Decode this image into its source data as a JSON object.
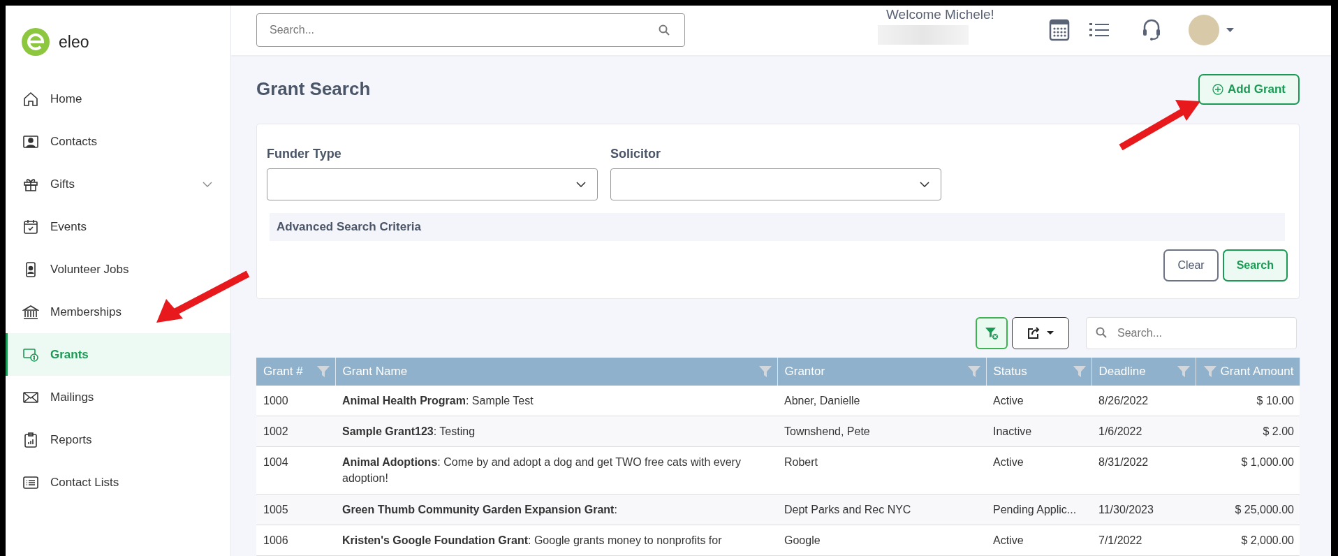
{
  "brand": {
    "name": "eleo"
  },
  "sidebar": {
    "items": [
      {
        "label": "Home",
        "kind": "link",
        "selected": false
      },
      {
        "label": "Contacts",
        "kind": "link",
        "selected": false
      },
      {
        "label": "Gifts",
        "kind": "group",
        "selected": false
      },
      {
        "label": "Events",
        "kind": "link",
        "selected": false
      },
      {
        "label": "Volunteer Jobs",
        "kind": "link",
        "selected": false
      },
      {
        "label": "Memberships",
        "kind": "link",
        "selected": false
      },
      {
        "label": "Grants",
        "kind": "link",
        "selected": true
      },
      {
        "label": "Mailings",
        "kind": "link",
        "selected": false
      },
      {
        "label": "Reports",
        "kind": "link",
        "selected": false
      },
      {
        "label": "Contact Lists",
        "kind": "link",
        "selected": false
      }
    ]
  },
  "header": {
    "search": {
      "placeholder": "Search..."
    },
    "welcome": "Welcome Michele!"
  },
  "page": {
    "title": "Grant Search",
    "add_button": "Add Grant"
  },
  "filters": {
    "fields": [
      {
        "label": "Funder Type"
      },
      {
        "label": "Solicitor"
      }
    ],
    "advanced": "Advanced Search Criteria",
    "buttons": [
      {
        "label": "Clear",
        "kind": "secondary"
      },
      {
        "label": "Search",
        "kind": "primary"
      }
    ]
  },
  "table": {
    "search": {
      "placeholder": "Search..."
    },
    "columns": [
      "Grant #",
      "Grant Name",
      "Grantor",
      "Status",
      "Deadline",
      "Grant Amount"
    ],
    "rows": [
      [
        "1000",
        "**Animal Health Program**: Sample Test",
        "Abner, Danielle",
        "Active",
        "8/26/2022",
        "$ 10.00"
      ],
      [
        "1002",
        "**Sample Grant123**: Testing",
        "Townshend, Pete",
        "Inactive",
        "1/6/2022",
        "$ 2.00"
      ],
      [
        "1004",
        "**Animal Adoptions**: Come by and adopt a dog and get TWO free cats with every adoption!",
        "Robert",
        "Active",
        "8/31/2022",
        "$ 1,000.00"
      ],
      [
        "1005",
        "**Green Thumb Community Garden Expansion Grant**:",
        "Dept Parks and Rec NYC",
        "Pending Applic...",
        "11/30/2023",
        "$ 25,000.00"
      ],
      [
        "1006",
        "**Kristen's Google Foundation Grant**: Google grants money to nonprofits for",
        "Google",
        "Active",
        "7/1/2022",
        "$ 2,000.00"
      ]
    ]
  }
}
